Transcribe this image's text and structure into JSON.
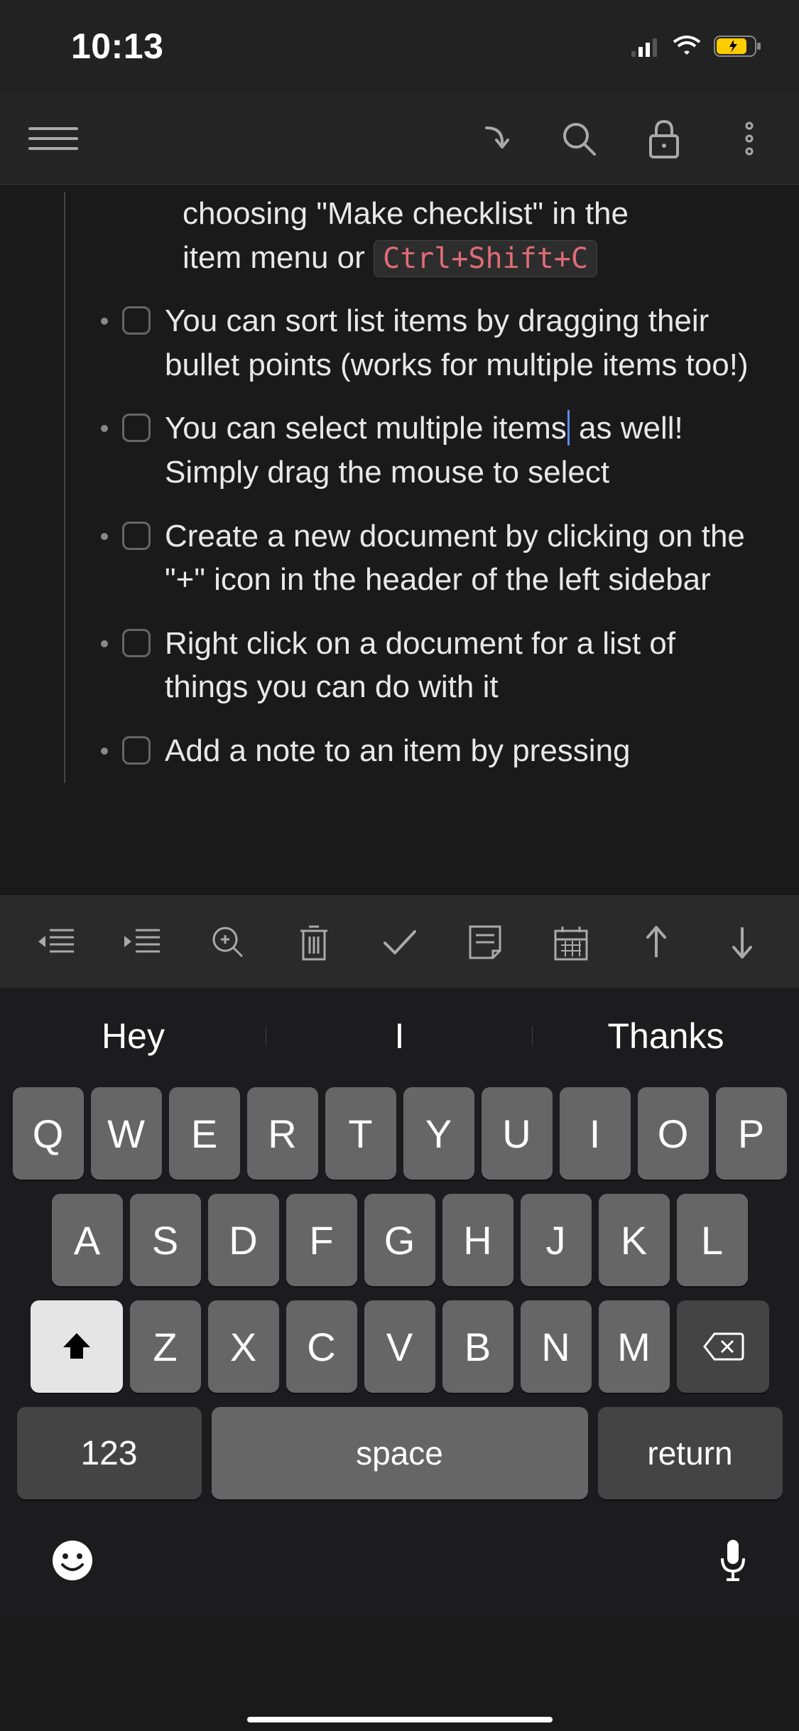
{
  "status": {
    "time": "10:13"
  },
  "note": {
    "partial_top_line1": "choosing \"Make checklist\" in the",
    "partial_top_line2_prefix": "item menu or ",
    "partial_top_kbd": "Ctrl+Shift+C",
    "items": [
      {
        "text": "You can sort list items by dragging their bullet points (works for multiple items too!)"
      },
      {
        "text_before": "You can select multiple items",
        "text_after": " as well! Simply drag the mouse to select",
        "cursor": true
      },
      {
        "text": "Create a new document by clicking on the \"+\" icon in the header of the left sidebar"
      },
      {
        "text": "Right click on a document for a list of things you can do with it"
      },
      {
        "text": "Add a note to an item by pressing"
      }
    ]
  },
  "keyboard": {
    "suggestions": [
      "Hey",
      "I",
      "Thanks"
    ],
    "row1": [
      "Q",
      "W",
      "E",
      "R",
      "T",
      "Y",
      "U",
      "I",
      "O",
      "P"
    ],
    "row2": [
      "A",
      "S",
      "D",
      "F",
      "G",
      "H",
      "J",
      "K",
      "L"
    ],
    "row3": [
      "Z",
      "X",
      "C",
      "V",
      "B",
      "N",
      "M"
    ],
    "num": "123",
    "space": "space",
    "return": "return"
  }
}
